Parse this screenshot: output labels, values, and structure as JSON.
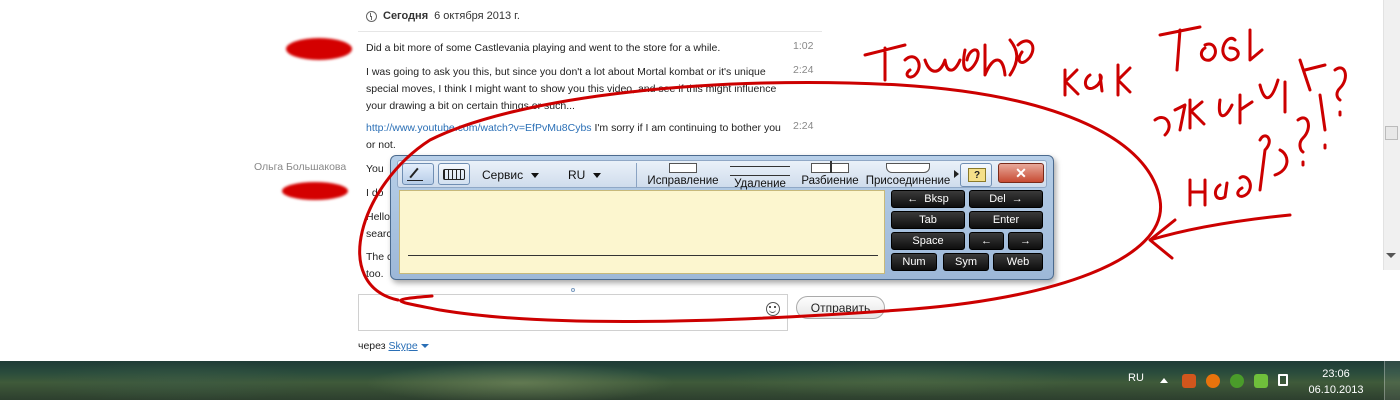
{
  "chat": {
    "date_header_bold": "Сегодня",
    "date_header_rest": "6 октября 2013 г.",
    "messages": [
      {
        "text": "Did a bit more of some Castlevania playing and went to the store for a while.",
        "time": "1:02"
      },
      {
        "text": "I was going to ask you this, but since you don't a lot about Mortal kombat or it's unique special moves, I think I might want to show you this video, and see if this might influence your drawing a bit on certain things or such...",
        "time": "2:24"
      },
      {
        "link": "http://www.youtube.com/watch?v=EfPvMu8Cybs",
        "text": " I'm sorry if I am continuing to bother you or not.",
        "time": "2:24"
      },
      {
        "text": "You"
      },
      {
        "text": "I do"
      },
      {
        "text": "Hello search"
      },
      {
        "text": "The c too."
      }
    ],
    "sender_name": "Ольга Большакова",
    "send_button": "Отправить",
    "via_label": "через",
    "via_link": "Skype"
  },
  "input_panel": {
    "menu_service": "Сервис",
    "menu_lang": "RU",
    "gestures": [
      "Исправление",
      "Удаление",
      "Разбиение",
      "Присоединение"
    ],
    "close_label": "✕",
    "help_label": "?",
    "keys": {
      "bksp": "Bksp",
      "del": "Del",
      "tab": "Tab",
      "enter": "Enter",
      "space": "Space",
      "num": "Num",
      "sym": "Sym",
      "web": "Web"
    }
  },
  "annotation": {
    "handwritten_text": "Творина, как тебя отключить на фиг?!?",
    "color": "#cc0000"
  },
  "taskbar": {
    "language": "RU",
    "time": "23:06",
    "date": "06.10.2013"
  },
  "colors": {
    "link": "#2a6fb6",
    "redaction": "#d40000",
    "panel_write_area": "#fcf6cf"
  }
}
